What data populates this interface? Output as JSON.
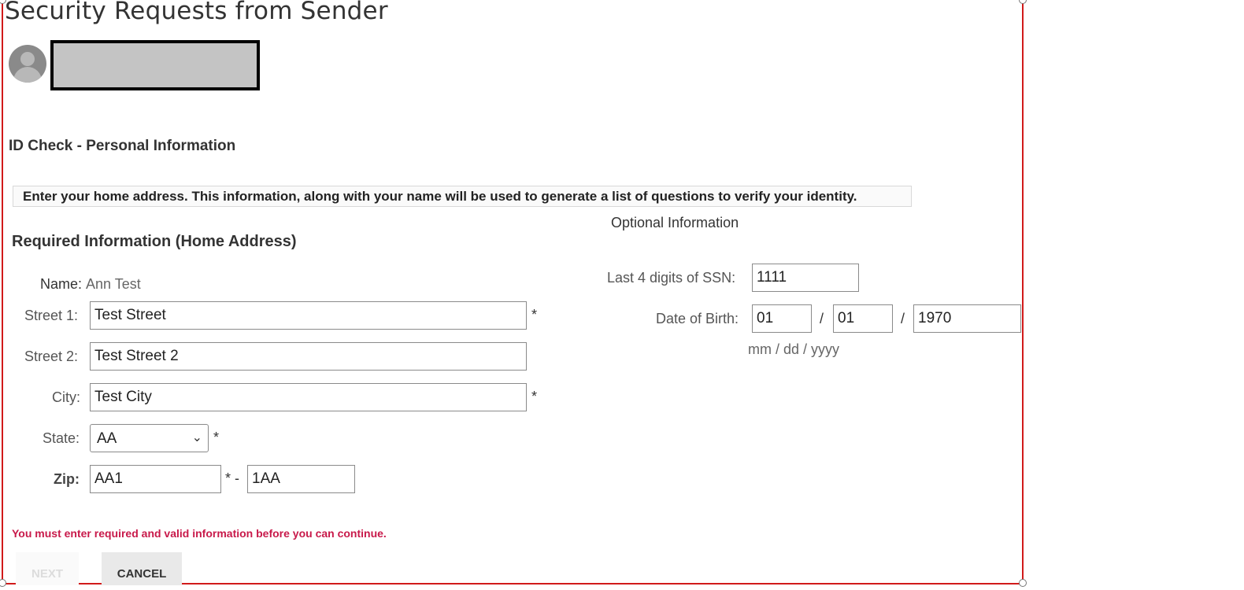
{
  "page": {
    "title": "Security Requests from Sender",
    "section_title": "ID Check - Personal Information",
    "instruction": "Enter your home address. This information, along with your name will be used to generate a list of questions to verify your identity."
  },
  "required": {
    "title": "Required Information (Home Address)",
    "name_label": "Name:",
    "name_value": "Ann Test",
    "street1_label": "Street 1:",
    "street1_value": "Test Street",
    "street2_label": "Street 2:",
    "street2_value": "Test Street 2",
    "city_label": "City:",
    "city_value": "Test City",
    "state_label": "State:",
    "state_value": "AA",
    "zip_label": "Zip:",
    "zip_value": "AA1",
    "zip_ext_value": "1AA",
    "required_marker": "*",
    "zip_separator": "* -"
  },
  "optional": {
    "title": "Optional Information",
    "ssn_label": "Last 4 digits of SSN:",
    "ssn_value": "1111",
    "dob_label": "Date of Birth:",
    "dob_month": "01",
    "dob_day": "01",
    "dob_year": "1970",
    "dob_separator": "/",
    "dob_hint": "mm / dd / yyyy"
  },
  "error": "You must enter required and valid information before you can continue.",
  "buttons": {
    "next": "NEXT",
    "cancel": "CANCEL"
  },
  "colors": {
    "frame_border": "#d11a1a",
    "error_text": "#c8194a"
  },
  "icons": {
    "avatar": "user-avatar-icon",
    "select_arrow": "chevron-down-icon"
  }
}
